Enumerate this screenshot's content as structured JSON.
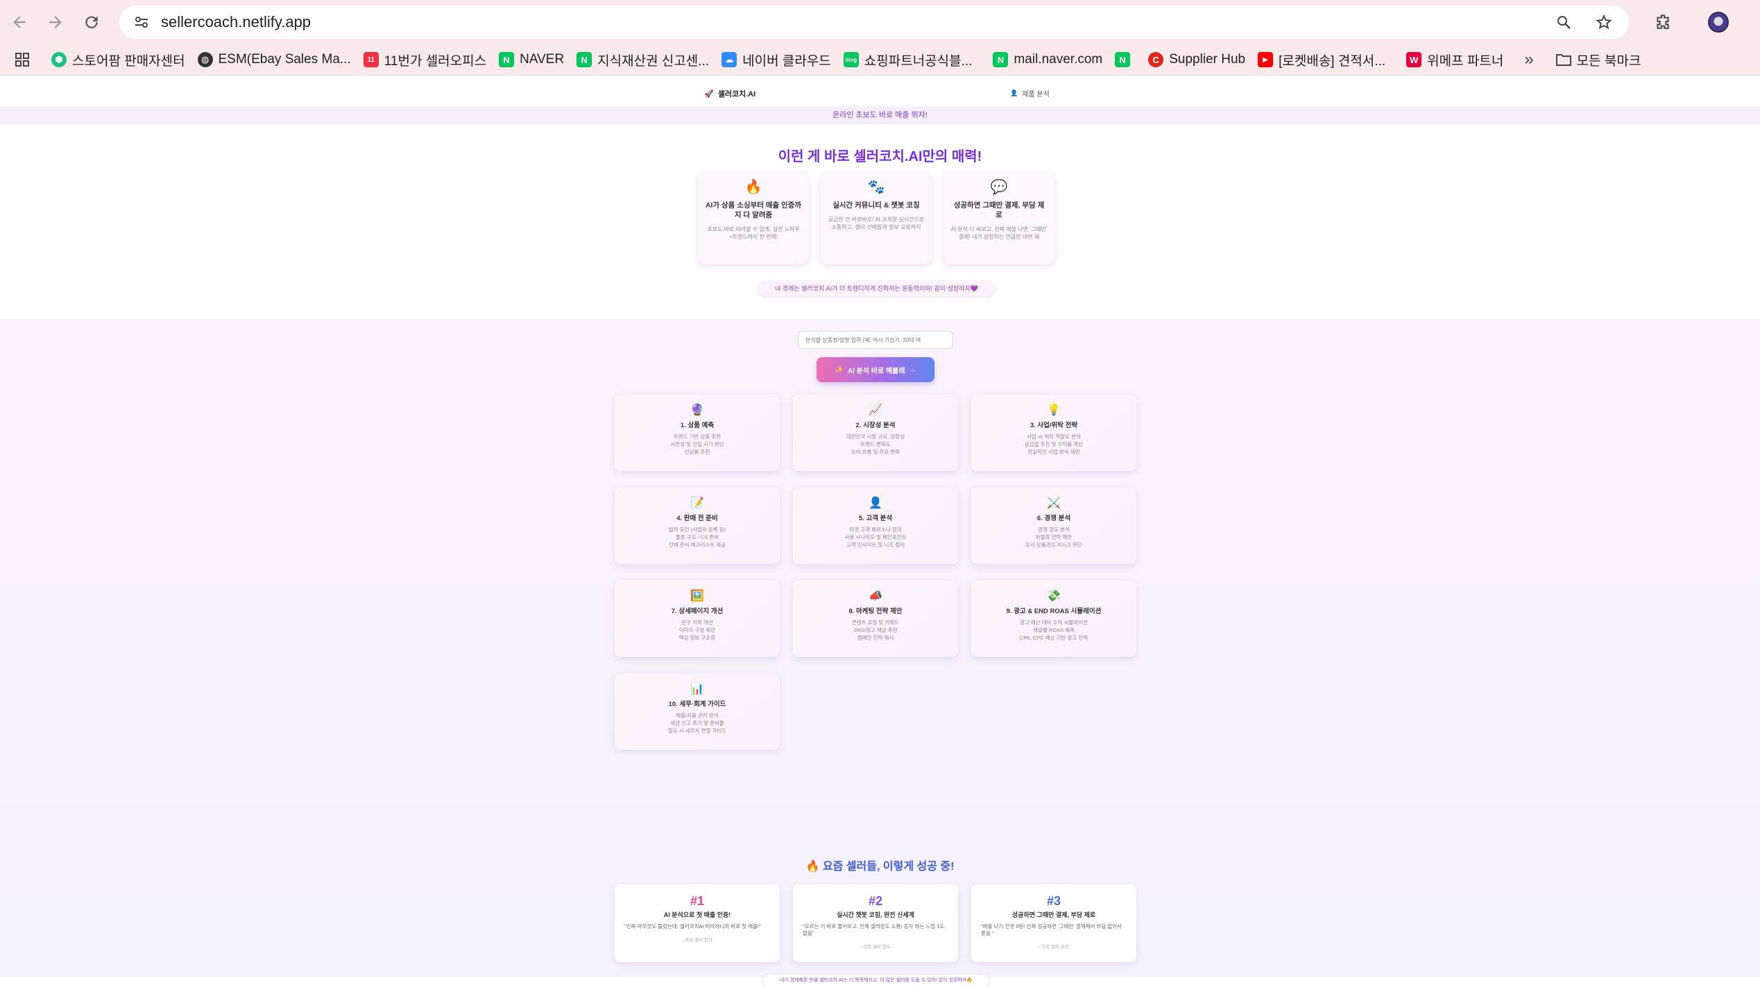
{
  "browser": {
    "url": "sellercoach.netlify.app",
    "bookmarks": [
      {
        "label": "스토어팜 판매자센터",
        "icon": "store-icon",
        "color": "#19c37d"
      },
      {
        "label": "ESM(Ebay Sales Ma...",
        "icon": "globe-icon",
        "color": "#333333"
      },
      {
        "label": "11번가 셀러오피스",
        "icon": "11st-icon",
        "color": "#f43142"
      },
      {
        "label": "NAVER",
        "icon": "naver-icon",
        "color": "#03c75a"
      },
      {
        "label": "지식재산권 신고센...",
        "icon": "naver-icon",
        "color": "#03c75a"
      },
      {
        "label": "네이버 클라우드",
        "icon": "cloud-icon",
        "color": "#2f8cff"
      },
      {
        "label": "쇼핑파트너공식블...",
        "icon": "blog-icon",
        "color": "#03c75a"
      },
      {
        "label": "mail.naver.com",
        "icon": "naver-icon",
        "color": "#03c75a"
      },
      {
        "label": "",
        "icon": "naver-icon",
        "color": "#03c75a"
      },
      {
        "label": "Supplier Hub",
        "icon": "coupang-icon",
        "color": "#e1251b"
      },
      {
        "label": "[로켓배송] 견적서...",
        "icon": "youtube-icon",
        "color": "#ff0000"
      },
      {
        "label": "위메프 파트너",
        "icon": "wemakeprice-icon",
        "color": "#e8003a"
      }
    ],
    "all_bookmarks": "모든 북마크"
  },
  "nav": {
    "brand": "셀러코치.AI",
    "link": "제품 분석"
  },
  "banner": "온라인 초보도 바로 매출 뛰자!",
  "hero": {
    "title": "이런 게 바로 셀러코치.AI만의 매력!",
    "features": [
      {
        "icon": "fire-icon",
        "title": "AI가 상품 소싱부터 매출 인증까지 다 알려줌",
        "desc": "초보도 바로 따라할 수 있게, 실전 노하우+트렌드까지 한 번에!"
      },
      {
        "icon": "paw-icon",
        "title": "실시간 커뮤니티 & 챗봇 코칭",
        "desc": "궁금한 건 바로바로! AI 코치랑 실시간으로 소통하고, 셀러 선배들과 정보 교류까지"
      },
      {
        "icon": "chat-bubbles-icon",
        "title": "성공하면 그때만 결제, 부담 제로",
        "desc": "AI 분석 다 써보고, 진짜 매출 나면 '그때만' 결제! 내가 성장하는 만큼만 내면 돼"
      }
    ],
    "note": "내 경제는 셀러코치.AI가 더 트렌디하게 진화하는 원동력이야! 같이 성장하자💜"
  },
  "search": {
    "placeholder": "분석할 상품명/설명 입력 (예: 여시 가습기, 20대 여"
  },
  "cta": {
    "label": "AI 분석 바로 해볼래"
  },
  "steps": [
    {
      "icon": "crystal-ball-icon",
      "title": "1. 상품 예측",
      "lines": [
        "트렌드 기반 상품 추천",
        "시즌성 및 진입 시기 판단",
        "신상품 추천"
      ]
    },
    {
      "icon": "chart-up-icon",
      "title": "2. 시장성 분석",
      "lines": [
        "대한민국 시장 규모, 성장성",
        "트렌드 변화도",
        "소비 흐름 및 주요 변화"
      ]
    },
    {
      "icon": "lightbulb-icon",
      "title": "3. 사업/위탁 전략",
      "lines": [
        "사업 vs 위탁 적합도 분석",
        "공급업 추천 및 수익률 계산",
        "현실적인 사업 방식 제안"
      ]
    },
    {
      "icon": "memo-icon",
      "title": "4. 판매 전 준비",
      "lines": [
        "법적 요건 (사업자 등록 등)",
        "물류 구조 / CS 준비",
        "전체 준비 체크리스트 제공"
      ]
    },
    {
      "icon": "person-icon",
      "title": "5. 고객 분석",
      "lines": [
        "타겟 고객 페르소나 정의",
        "사용 시나리오 및 페인포인트",
        "고객 인사이트 및 니즈 정리"
      ]
    },
    {
      "icon": "swords-icon",
      "title": "6. 경쟁 분석",
      "lines": [
        "경쟁 강도 분석",
        "차별화 전략 제안",
        "유사 상품과의 리스크 판단"
      ]
    },
    {
      "icon": "picture-icon",
      "title": "7. 상세페이지 개선",
      "lines": [
        "문구 카피 개선",
        "이미지 구성 제안",
        "핵심 정보 구조화"
      ]
    },
    {
      "icon": "megaphone-icon",
      "title": "8. 마케팅 전략 제안",
      "lines": [
        "콘텐츠 유형 및 키워드",
        "SNS/광고 채널 추천",
        "캠페인 전략 예시"
      ]
    },
    {
      "icon": "money-icon",
      "title": "9. 광고 & END ROAS 시뮬레이션",
      "lines": [
        "광고 예산 대비 수익 시뮬레이션",
        "채널별 ROAS 예측",
        "CPA, CPC 예산 기반 광고 전략"
      ]
    },
    {
      "icon": "bar-chart-icon",
      "title": "10. 세무·회계 가이드",
      "lines": [
        "매출/지출 관리 방식",
        "세금 신고 주기 및 준비물",
        "필요 시 세무사 연결 가이드"
      ]
    }
  ],
  "success": {
    "title": "요즘 셀러들, 이렇게 성공 중!",
    "cards": [
      {
        "num": "#1",
        "num_color": "#e0439a",
        "title": "AI 분석으로 첫 매출 인증!",
        "quote": "\"진짜 아무것도 몰랐는데, 셀러코치AI 따라하니까 바로 첫 매출!\"",
        "author": "- 초보 셀러 민지"
      },
      {
        "num": "#2",
        "num_color": "#8b4fe0",
        "title": "실시간 챗봇 코칭, 완전 신세계",
        "quote": "\"모르는 거 바로 물어보고, 인에 셀러랑도 소통! 혼자 하는 느낌 1도 없음\"",
        "author": "- 성장 셀러 현도"
      },
      {
        "num": "#3",
        "num_color": "#3d6fe0",
        "title": "성공하면 그때만 결제, 부담 제로",
        "quote": "\"매출 나기 전엔 0원! 진짜 성공하면 '그때만' 결제해서 부담 없어서 좋음.\"",
        "author": "- 자유 셀러 수진"
      }
    ],
    "note": "내가 경제해준 만큼 셀러코치.AI는 더 똑똑해지고, 더 많은 셀러를 도울 수 있어! 같이 성장하자🔥"
  }
}
